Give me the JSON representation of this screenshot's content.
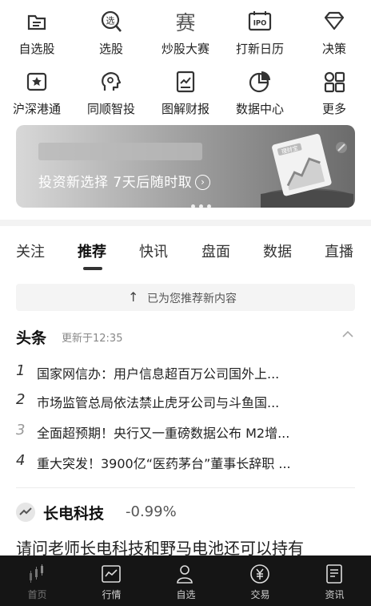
{
  "quick_menu": {
    "row1": [
      {
        "label": "自选股",
        "icon": "watchlist-icon"
      },
      {
        "label": "选股",
        "icon": "stock-picker-icon"
      },
      {
        "label": "炒股大赛",
        "icon": "contest-icon"
      },
      {
        "label": "打新日历",
        "icon": "ipo-calendar-icon"
      },
      {
        "label": "决策",
        "icon": "diamond-icon"
      }
    ],
    "row2": [
      {
        "label": "沪深港通",
        "icon": "connect-icon"
      },
      {
        "label": "同顺智投",
        "icon": "ai-invest-icon"
      },
      {
        "label": "图解财报",
        "icon": "report-icon"
      },
      {
        "label": "数据中心",
        "icon": "pie-chart-icon"
      },
      {
        "label": "更多",
        "icon": "more-grid-icon"
      }
    ],
    "ipo_badge": "IPO",
    "xuan_badge": "选",
    "sai_badge": "赛"
  },
  "banner": {
    "text": "投资新选择 7天后随时取",
    "arrow": "›",
    "art_label": "理财宝"
  },
  "tabs": [
    "关注",
    "推荐",
    "快讯",
    "盘面",
    "数据",
    "直播"
  ],
  "active_tab": "推荐",
  "notice": {
    "arrow": "↑",
    "text": "已为您推荐新内容"
  },
  "headlines": {
    "title": "头条",
    "updated": "更新于12:35",
    "items": [
      {
        "num": "1",
        "title": "国家网信办：用户信息超百万公司国外上..."
      },
      {
        "num": "2",
        "title": "市场监管总局依法禁止虎牙公司与斗鱼国..."
      },
      {
        "num": "3",
        "title": "全面超预期！央行又一重磅数据公布 M2增..."
      },
      {
        "num": "4",
        "title": "重大突发！3900亿“医药茅台”董事长辞职 ..."
      }
    ]
  },
  "stock_post": {
    "name": "长电科技",
    "change": "-0.99%",
    "text": "请问老师长电科技和野马电池还可以持有"
  },
  "bottom_nav": [
    {
      "label": "首页",
      "icon": "home-chart-icon"
    },
    {
      "label": "行情",
      "icon": "market-icon"
    },
    {
      "label": "自选",
      "icon": "watchlist-person-icon"
    },
    {
      "label": "交易",
      "icon": "trade-yen-icon"
    },
    {
      "label": "资讯",
      "icon": "news-doc-icon"
    }
  ]
}
